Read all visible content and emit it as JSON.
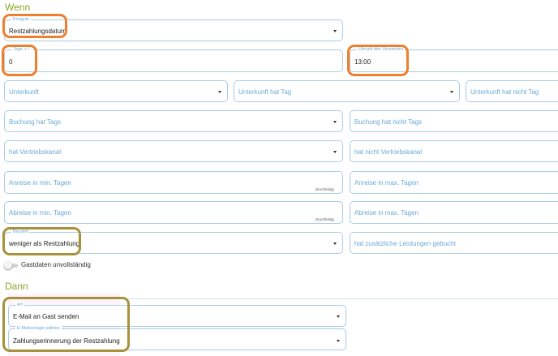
{
  "wenn": {
    "title": "Wenn",
    "ereignis": {
      "label": "Ereignis",
      "value": "Restzahlungsdatum"
    },
    "tage": {
      "label": "Tage + / -",
      "value": "0"
    },
    "uhrzeit": {
      "label": "Uhrzeit des Versandes",
      "value": "13:00"
    },
    "unterkunft": "Unterkunft",
    "unterkunft_hat_tag": "Unterkunft hat Tag",
    "unterkunft_hat_nicht_tag": "Unterkunft hat nicht Tag",
    "buchung_hat_tags": "Buchung hat Tags",
    "buchung_hat_nicht_tags": "Buchung hat nicht Tags",
    "hat_vertriebskanal": "hat Vertriebskanal",
    "hat_nicht_vertriebskanal": "hat nicht Vertriebskanal",
    "anreise_min": {
      "placeholder": "Anreise in min. Tagen",
      "hint": "(Kurzfristig)"
    },
    "anreise_max": "Anreise in max. Tagen",
    "abreise_min": {
      "placeholder": "Abreise in min. Tagen",
      "hint": "(Kurzfristig)"
    },
    "abreise_max": "Abreise in max. Tagen",
    "bezahlt": {
      "label": "Bezahlt",
      "value": "weniger als Restzahlung"
    },
    "zusaetzliche_leistungen": "hat zusätzliche Leistungen gebucht",
    "gastdaten_toggle": "Gastdaten unvollständig"
  },
  "dann": {
    "title": "Dann",
    "art": {
      "label": "Art",
      "value": "E-Mail an Gast senden"
    },
    "vorlage": {
      "label": "E-Mailvorlage wählen",
      "value": "Zahlungserinnerung der Restzahlung"
    }
  },
  "colors": {
    "accent_green": "#8aa626",
    "field_border": "#a9cde3",
    "placeholder_blue": "#6aa9d8",
    "highlight_orange": "#ee7f2d",
    "highlight_olive": "#a7913a"
  }
}
